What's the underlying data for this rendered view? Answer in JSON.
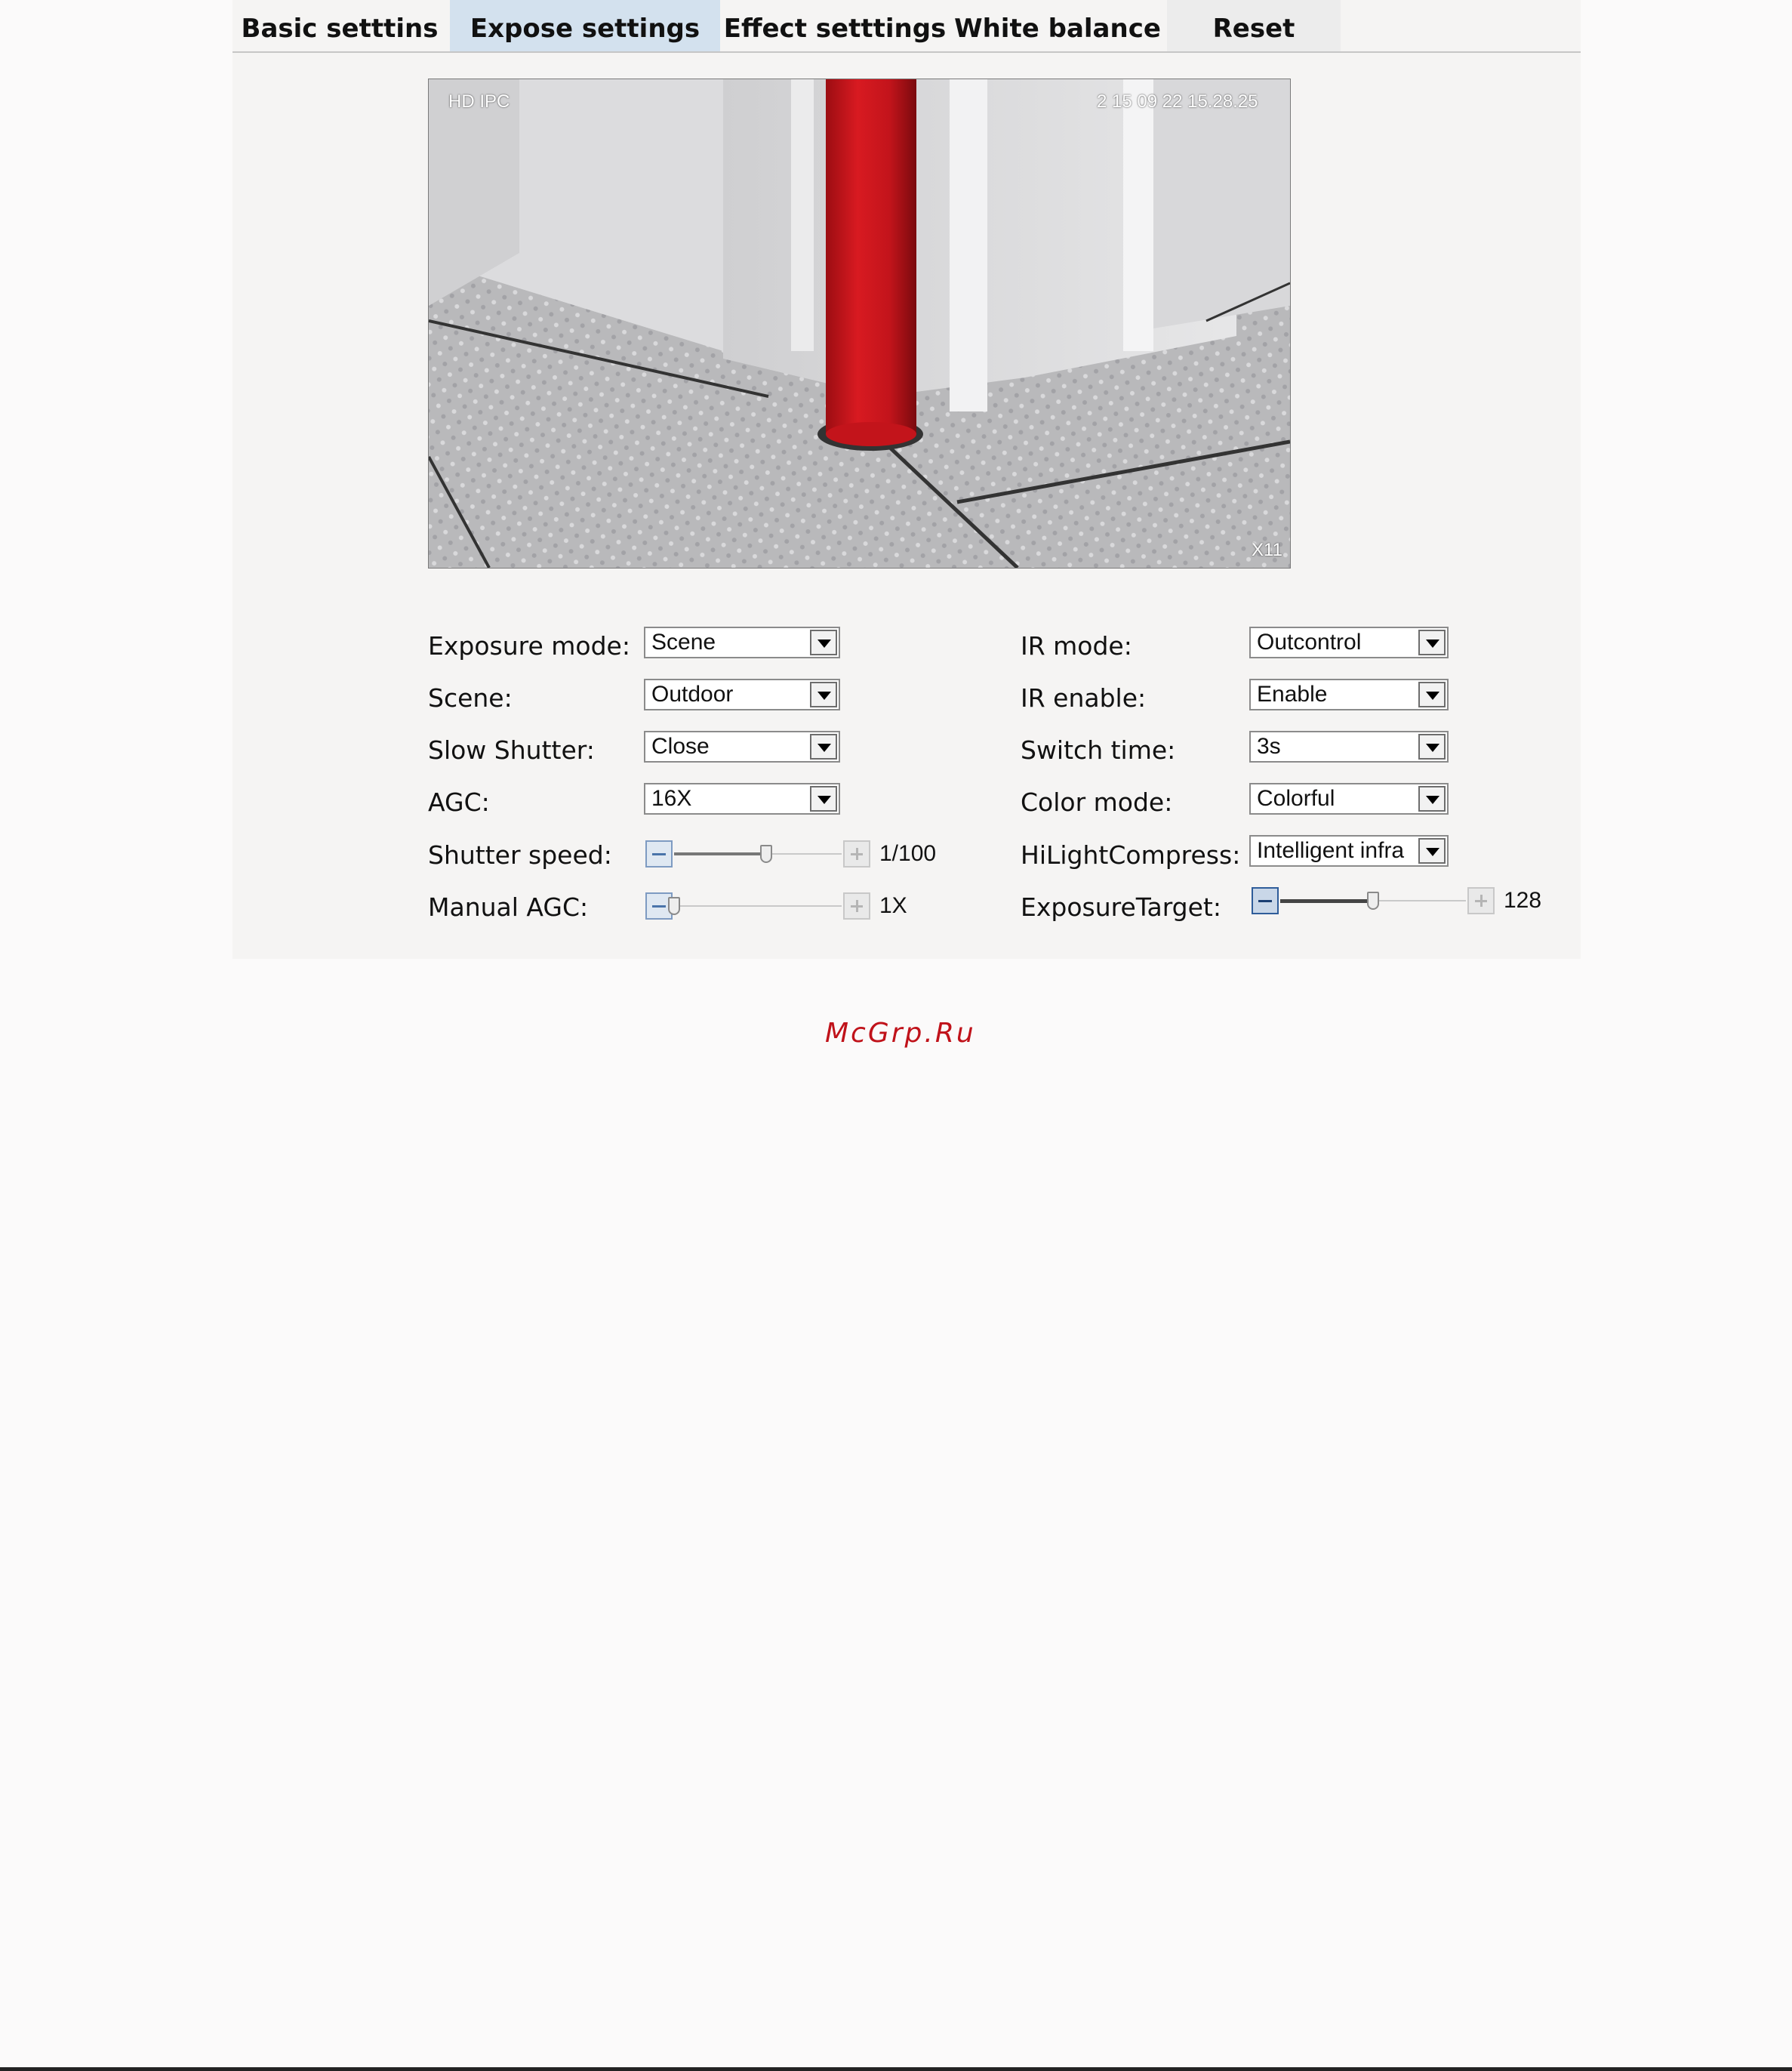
{
  "tabs": [
    {
      "label": "Basic setttins",
      "active": false
    },
    {
      "label": "Expose settings",
      "active": true
    },
    {
      "label": "Effect setttings",
      "active": false
    },
    {
      "label": "White balance",
      "active": false
    },
    {
      "label": "Reset",
      "active": false
    }
  ],
  "preview": {
    "osd_title": "HD IPC",
    "osd_timestamp": "2 15 09 22 15.28.25",
    "osd_zoom": "X11"
  },
  "left_settings": {
    "exposure_mode": {
      "label": "Exposure mode:",
      "value": "Scene"
    },
    "scene": {
      "label": "Scene:",
      "value": "Outdoor"
    },
    "slow_shutter": {
      "label": "Slow Shutter:",
      "value": "Close"
    },
    "agc": {
      "label": "AGC:",
      "value": "16X"
    },
    "shutter_speed": {
      "label": "Shutter speed:",
      "value": "1/100",
      "level": 0.55
    },
    "manual_agc": {
      "label": "Manual AGC:",
      "value": "1X",
      "level": 0.0
    }
  },
  "right_settings": {
    "ir_mode": {
      "label": "IR mode:",
      "value": "Outcontrol"
    },
    "ir_enable": {
      "label": "IR enable:",
      "value": "Enable"
    },
    "switch_time": {
      "label": "Switch time:",
      "value": "3s"
    },
    "color_mode": {
      "label": "Color mode:",
      "value": "Colorful"
    },
    "hilight_compress": {
      "label": "HiLightCompress:",
      "value": "Intelligent infra"
    },
    "exposure_target": {
      "label": "ExposureTarget:",
      "value": "128",
      "level": 0.5
    }
  },
  "watermark": "McGrp.Ru",
  "colors": {
    "active_tab": "#d3e1ee",
    "watermark": "#c0121a",
    "panel": "#f5f4f3"
  }
}
